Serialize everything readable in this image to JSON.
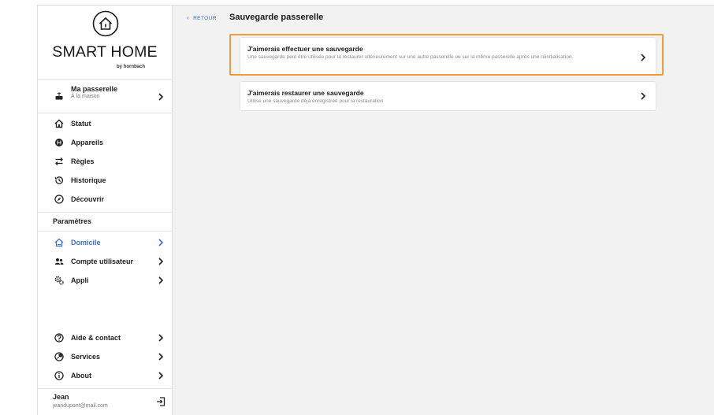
{
  "brand": {
    "name": "SMART HOME",
    "sub": "by hornbach"
  },
  "gateway": {
    "title": "Ma passerelle",
    "subtitle": "À la maison"
  },
  "nav": [
    {
      "label": "Statut",
      "icon": "house-icon"
    },
    {
      "label": "Appareils",
      "icon": "devices-icon"
    },
    {
      "label": "Règles",
      "icon": "rules-icon"
    },
    {
      "label": "Historique",
      "icon": "history-icon"
    },
    {
      "label": "Découvrir",
      "icon": "compass-icon"
    }
  ],
  "settings": {
    "section_label": "Paramètres",
    "items": [
      {
        "label": "Domicile",
        "active": true
      },
      {
        "label": "Compte utilisateur",
        "active": false
      },
      {
        "label": "Appli",
        "active": false
      }
    ]
  },
  "help": [
    {
      "label": "Aide & contact"
    },
    {
      "label": "Services"
    },
    {
      "label": "About"
    }
  ],
  "user": {
    "name": "Jean",
    "email": "jeandupont@mail.com"
  },
  "header": {
    "back_label": "RETOUR",
    "title": "Sauvegarde passerelle"
  },
  "cards": [
    {
      "title": "J'aimerais effectuer une sauvegarde",
      "description": "Une sauvegarde peut être utilisée pour la restaurer ultérieurement sur une autre passerelle ou sur la même passerelle après une réinitialisation."
    },
    {
      "title": "J'aimerais restaurer une sauvegarde",
      "description": "Utilise une sauvegarde déjà enregistrée pour la restauration"
    }
  ],
  "colors": {
    "accent": "#3a6fd0",
    "highlight": "#f39a3d",
    "background": "#f2f2f2"
  }
}
